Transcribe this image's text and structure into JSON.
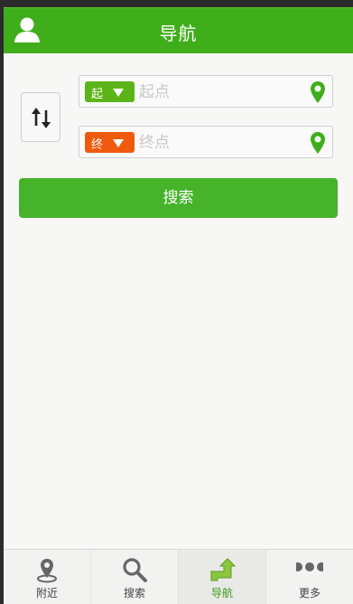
{
  "header": {
    "title": "导航"
  },
  "route": {
    "start": {
      "tag": "起",
      "placeholder": "起点",
      "value": ""
    },
    "end": {
      "tag": "终",
      "placeholder": "终点",
      "value": ""
    }
  },
  "actions": {
    "search_label": "搜索"
  },
  "tabs": [
    {
      "label": "附近",
      "icon": "location-pin-icon",
      "active": false
    },
    {
      "label": "搜索",
      "icon": "magnifier-icon",
      "active": false
    },
    {
      "label": "导航",
      "icon": "route-arrow-icon",
      "active": true
    },
    {
      "label": "更多",
      "icon": "more-dots-icon",
      "active": false
    }
  ],
  "colors": {
    "accent": "#46b32a",
    "start_tag": "#5bb418",
    "end_tag": "#f05a0e",
    "pin": "#3fae1a"
  }
}
